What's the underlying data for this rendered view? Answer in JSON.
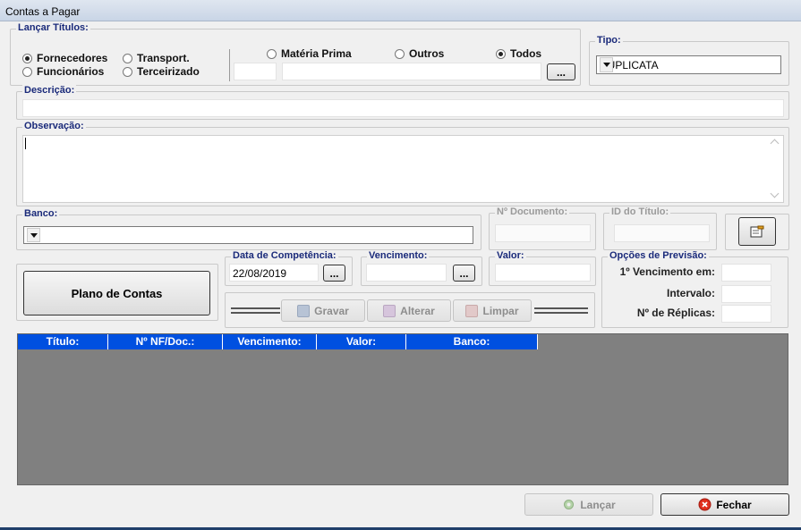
{
  "window": {
    "title": "Contas a Pagar"
  },
  "lancar": {
    "legend": "Lançar Títulos:",
    "fornecedores": "Fornecedores",
    "transport": "Transport.",
    "funcionarios": "Funcionários",
    "terceirizado": "Terceirizado",
    "selected": "Fornecedores"
  },
  "materia": {
    "materia_prima": "Matéria Prima",
    "outros": "Outros",
    "todos": "Todos",
    "selected": "Todos",
    "lookup_btn": "..."
  },
  "tipo": {
    "legend": "Tipo:",
    "value": "DUPLICATA"
  },
  "descricao": {
    "legend": "Descrição:",
    "value": ""
  },
  "observacao": {
    "legend": "Observação:",
    "value": ""
  },
  "banco": {
    "legend": "Banco:",
    "value": ""
  },
  "documento": {
    "legend": "Nº Documento:",
    "value": ""
  },
  "id_titulo": {
    "legend": "ID do Título:",
    "value": ""
  },
  "plano": {
    "label": "Plano de Contas"
  },
  "competencia": {
    "legend": "Data de Competência:",
    "value": "22/08/2019",
    "btn": "..."
  },
  "vencimento": {
    "legend": "Vencimento:",
    "value": "",
    "btn": "..."
  },
  "valor": {
    "legend": "Valor:",
    "value": ""
  },
  "actions": {
    "gravar": "Gravar",
    "alterar": "Alterar",
    "limpar": "Limpar"
  },
  "previsao": {
    "legend": "Opções de Previsão:",
    "primeiro": "1º Vencimento em:",
    "intervalo": "Intervalo:",
    "replicas": "Nº de Réplicas:"
  },
  "grid": {
    "columns": [
      "Título:",
      "Nº NF/Doc.:",
      "Vencimento:",
      "Valor:",
      "Banco:"
    ]
  },
  "footer": {
    "lancar": "Lançar",
    "fechar": "Fechar"
  },
  "colors": {
    "accent": "#1a2a7a",
    "grid_header": "#0050e0",
    "grid_bg": "#808080"
  }
}
